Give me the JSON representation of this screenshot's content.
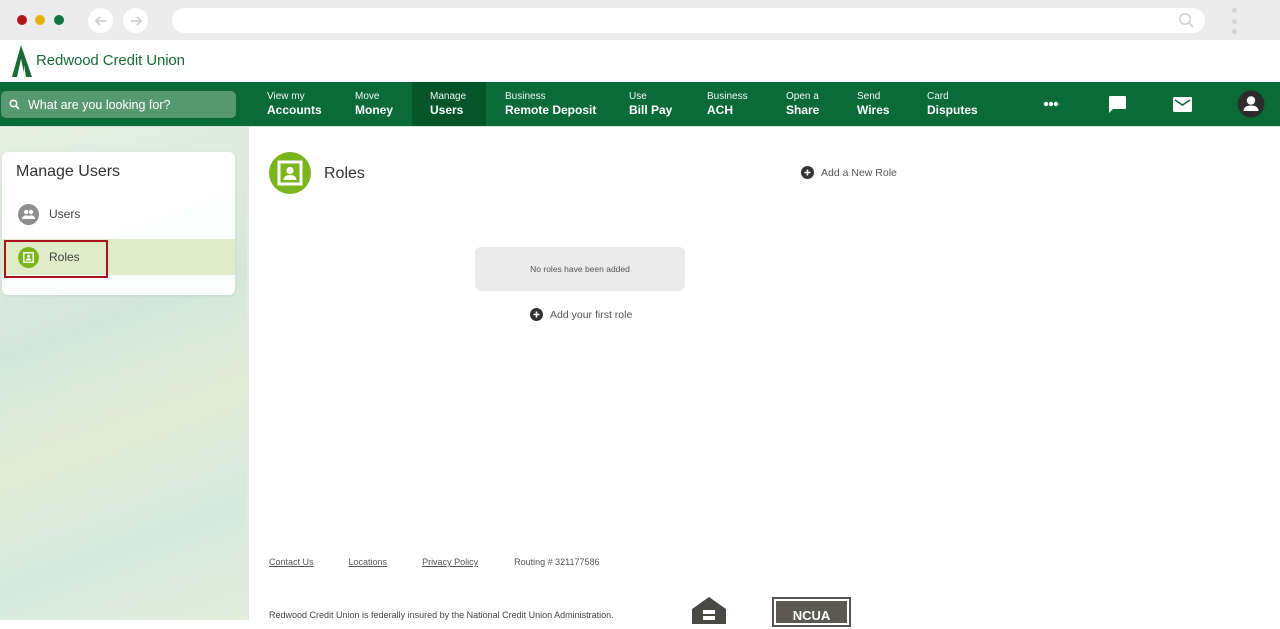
{
  "browser": {
    "url": "",
    "traffic_lights": [
      "close",
      "minimize",
      "maximize"
    ]
  },
  "brand": {
    "name": "Redwood Credit Union",
    "primary_color": "#0b6b37",
    "accent_color": "#7ab51d",
    "highlight_color": "#a3141c"
  },
  "search": {
    "placeholder": "What are you looking for?"
  },
  "nav": {
    "items": [
      {
        "small": "View my",
        "big": "Accounts"
      },
      {
        "small": "Move",
        "big": "Money"
      },
      {
        "small": "Manage",
        "big": "Users",
        "active": true
      },
      {
        "small": "Business",
        "big": "Remote Deposit"
      },
      {
        "small": "Use",
        "big": "Bill Pay"
      },
      {
        "small": "Business",
        "big": "ACH"
      },
      {
        "small": "Open a",
        "big": "Share"
      },
      {
        "small": "Send",
        "big": "Wires"
      },
      {
        "small": "Card",
        "big": "Disputes"
      }
    ],
    "icons": [
      "more-icon",
      "chat-icon",
      "mail-icon",
      "profile-icon"
    ]
  },
  "sidebar": {
    "title": "Manage Users",
    "items": [
      {
        "label": "Users",
        "icon": "users-icon",
        "selected": false
      },
      {
        "label": "Roles",
        "icon": "role-badge-icon",
        "selected": true
      }
    ]
  },
  "main": {
    "title": "Roles",
    "add_new_role": "Add a New Role",
    "empty_message": "No roles have been added",
    "add_first_role": "Add your first role"
  },
  "footer": {
    "links": [
      "Contact Us",
      "Locations",
      "Privacy Policy"
    ],
    "routing": "Routing # 321177586",
    "insured_text": "Redwood Credit Union is federally insured by the National Credit Union Administration.",
    "ncua_label": "NCUA"
  }
}
